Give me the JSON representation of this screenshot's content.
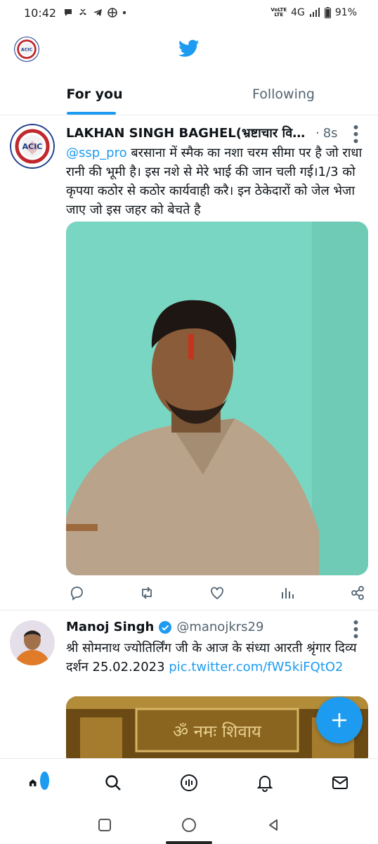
{
  "status_bar": {
    "time": "10:42",
    "network_top": "VoLTE",
    "network_bottom": "LTE",
    "network": "4G",
    "battery": "91%"
  },
  "tabs": [
    {
      "label": "For you",
      "active": true
    },
    {
      "label": "Following",
      "active": false
    }
  ],
  "tweets": [
    {
      "author": "LAKHAN SINGH BAGHEL(भ्रष्टाचार विरो...",
      "time": "8s",
      "mention": "@ssp_pro",
      "text": " बरसाना में स्मैक का नशा चरम सीमा पर है जो राधा रानी की भूमी है। इस नशे से मेरे भाई की जान चली गई।1/3 को कृपया कठोर से कठोर कार्यवाही करै। इन ठेकेदारों को जेल भेजा जाए जो इस जहर को बेचते है",
      "avatar_text": "ACIC"
    },
    {
      "author": "Manoj Singh",
      "verified": true,
      "handle": "@manojkrs29",
      "text": "श्री सोमनाथ ज्योतिर्लिंग जी के आज के संध्या आरती श्रृंगार दिव्य दर्शन 25.02.2023 ",
      "link": "pic.twitter.com/fW5kiFQtO2",
      "media_text": "ॐ नमः शिवाय"
    }
  ],
  "header": {
    "avatar_text": "ACIC"
  },
  "colors": {
    "accent": "#1d9bf0",
    "text": "#0f1419",
    "muted": "#536471"
  },
  "icons": {
    "tweet_actions": [
      "reply-icon",
      "retweet-icon",
      "like-icon",
      "views-icon",
      "share-icon"
    ],
    "bottom_nav": [
      "home-icon",
      "search-icon",
      "spaces-icon",
      "notifications-icon",
      "messages-icon"
    ],
    "system_nav": [
      "recents-icon",
      "home-circle-icon",
      "back-icon"
    ]
  }
}
